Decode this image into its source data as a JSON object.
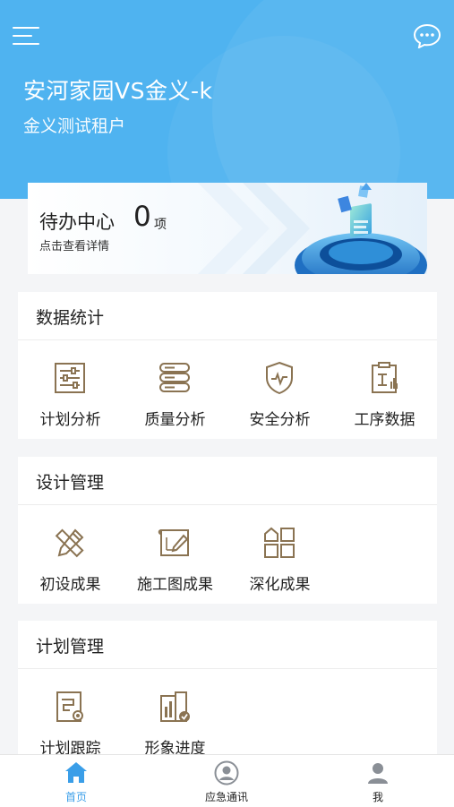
{
  "header": {
    "project_title": "安河家园VS金义-k",
    "tenant": "金义测试租户",
    "menu_icon": "hamburger-menu-icon",
    "chat_icon": "chat-bubble-icon",
    "bg_color": "#4fb3f0"
  },
  "todo": {
    "title": "待办中心",
    "count": "0",
    "unit": "项",
    "hint": "点击查看详情"
  },
  "sections": [
    {
      "title": "数据统计",
      "items": [
        {
          "label": "计划分析",
          "icon": "sliders-icon"
        },
        {
          "label": "质量分析",
          "icon": "database-icon"
        },
        {
          "label": "安全分析",
          "icon": "shield-icon"
        },
        {
          "label": "工序数据",
          "icon": "clipboard-chart-icon"
        }
      ]
    },
    {
      "title": "设计管理",
      "items": [
        {
          "label": "初设成果",
          "icon": "pencil-ruler-icon"
        },
        {
          "label": "施工图成果",
          "icon": "blueprint-icon"
        },
        {
          "label": "深化成果",
          "icon": "grid-icon"
        }
      ]
    },
    {
      "title": "计划管理",
      "items": [
        {
          "label": "计划跟踪",
          "icon": "tracking-doc-icon"
        },
        {
          "label": "形象进度",
          "icon": "building-progress-icon"
        }
      ]
    }
  ],
  "tabbar": {
    "tabs": [
      {
        "label": "首页",
        "icon": "home-icon",
        "active": true
      },
      {
        "label": "应急通讯",
        "icon": "contact-icon",
        "active": false
      },
      {
        "label": "我",
        "icon": "person-icon",
        "active": false
      }
    ],
    "active_color": "#3a9ee8",
    "inactive_color": "#222222"
  },
  "colors": {
    "icon_gold": "#8a7352"
  }
}
